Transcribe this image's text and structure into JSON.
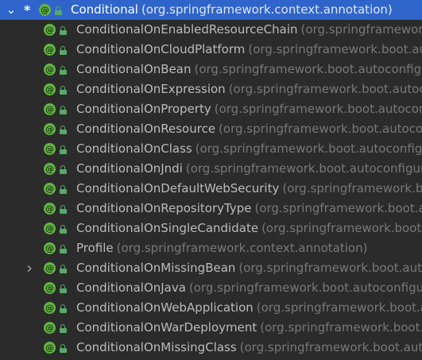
{
  "tree": {
    "root": {
      "name": "Conditional",
      "package": "(org.springframework.context.annotation)",
      "star": "*",
      "expanded": true
    },
    "children": [
      {
        "name": "ConditionalOnEnabledResourceChain",
        "package": "(org.springframework",
        "expandable": false
      },
      {
        "name": "ConditionalOnCloudPlatform",
        "package": "(org.springframework.boot.aut",
        "expandable": false
      },
      {
        "name": "ConditionalOnBean",
        "package": "(org.springframework.boot.autoconfigu",
        "expandable": false
      },
      {
        "name": "ConditionalOnExpression",
        "package": "(org.springframework.boot.autoco",
        "expandable": false
      },
      {
        "name": "ConditionalOnProperty",
        "package": "(org.springframework.boot.autocon",
        "expandable": false
      },
      {
        "name": "ConditionalOnResource",
        "package": "(org.springframework.boot.autocon",
        "expandable": false
      },
      {
        "name": "ConditionalOnClass",
        "package": "(org.springframework.boot.autoconfig",
        "expandable": false
      },
      {
        "name": "ConditionalOnJndi",
        "package": "(org.springframework.boot.autoconfigur",
        "expandable": false
      },
      {
        "name": "ConditionalOnDefaultWebSecurity",
        "package": "(org.springframework.boot",
        "expandable": false
      },
      {
        "name": "ConditionalOnRepositoryType",
        "package": "(org.springframework.boot.a",
        "expandable": false
      },
      {
        "name": "ConditionalOnSingleCandidate",
        "package": "(org.springframework.boot.a",
        "expandable": false
      },
      {
        "name": "Profile",
        "package": "(org.springframework.context.annotation)",
        "expandable": false
      },
      {
        "name": "ConditionalOnMissingBean",
        "package": "(org.springframework.boot.auto",
        "expandable": true
      },
      {
        "name": "ConditionalOnJava",
        "package": "(org.springframework.boot.autoconfigu",
        "expandable": false
      },
      {
        "name": "ConditionalOnWebApplication",
        "package": "(org.springframework.boot.a",
        "expandable": false
      },
      {
        "name": "ConditionalOnWarDeployment",
        "package": "(org.springframework.boot.a",
        "expandable": false
      },
      {
        "name": "ConditionalOnMissingClass",
        "package": "(org.springframework.boot.aut",
        "expandable": false
      }
    ]
  },
  "icons": {
    "annotation": "annotation-icon",
    "visibility": "public-lock-icon",
    "expanded": "chevron-down-icon",
    "collapsed": "chevron-right-icon",
    "annotation_glyph": "@"
  },
  "colors": {
    "background": "#2b2b2b",
    "selection": "#2f65ca",
    "annotation_icon": "#62b543",
    "name_text": "#bbbbbb",
    "package_text": "#787878"
  }
}
